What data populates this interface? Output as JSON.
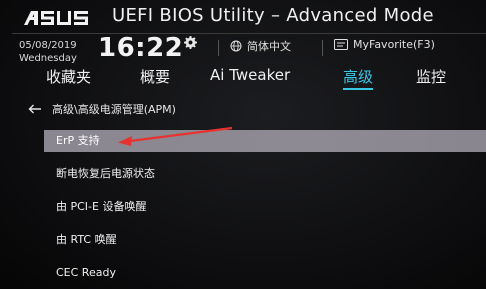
{
  "header": {
    "brand": "ASUS",
    "title": "UEFI BIOS Utility – Advanced Mode",
    "date": "05/08/2019",
    "weekday": "Wednesday",
    "time": "16:22",
    "language": "简体中文",
    "favorite": "MyFavorite(F3)"
  },
  "tabs": [
    {
      "label": "收藏夹",
      "active": false
    },
    {
      "label": "概要",
      "active": false
    },
    {
      "label": "Ai Tweaker",
      "active": false
    },
    {
      "label": "高级",
      "active": true
    },
    {
      "label": "监控",
      "active": false
    }
  ],
  "breadcrumb": "高级\\高级电源管理(APM)",
  "items": [
    {
      "label": "ErP 支持",
      "selected": true
    },
    {
      "label": "断电恢复后电源状态",
      "selected": false
    },
    {
      "label": "由 PCI-E 设备唤醒",
      "selected": false
    },
    {
      "label": "由 RTC 唤醒",
      "selected": false
    },
    {
      "label": "CEC Ready",
      "selected": false
    }
  ],
  "colors": {
    "accent": "#39c7e6",
    "selection": "#8c8992",
    "annotation_arrow": "#e8322f"
  },
  "icons": {
    "settings": "gear-icon",
    "language": "globe-icon",
    "favorite": "favorite-icon",
    "back": "back-arrow-icon"
  }
}
